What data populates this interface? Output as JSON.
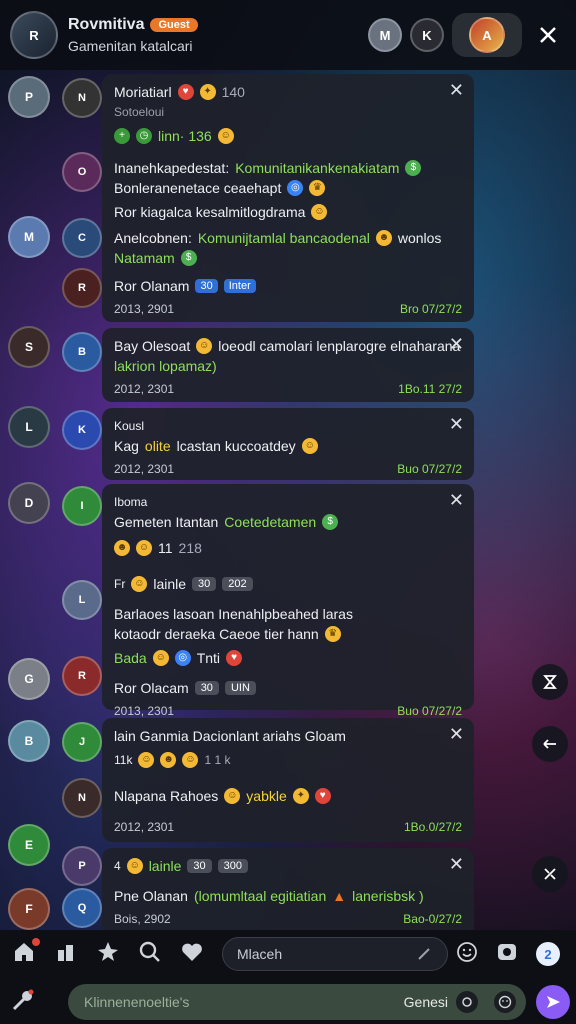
{
  "header": {
    "title": "Rovmitiva",
    "badge": "Guest",
    "subtitle": "Gamenitan katalcari"
  },
  "cards": [
    {
      "name": "Moriatiarl",
      "name_suffix": "140",
      "line2": "Sotoeloui",
      "line3": "linn· 136",
      "text1a": "Inanehkapedestat:",
      "text1b": "Komunitanikankenakiatam",
      "text2": "Bonleranenetace ceaehapt",
      "text3": "Ror kiagalca kesalmitlogdrama",
      "text4a": "Anelcobnen:",
      "text4b": "Komunijtamlal bancaodenal",
      "text4c": "wonlos",
      "text5": "Natamam",
      "name2": "Ror Olanam",
      "pill_a": "30",
      "pill_b": "Inter",
      "date": "2013, 2901",
      "time": "Bro 07/27/2"
    },
    {
      "line1": "Bay Olesoat",
      "line1b": "loeodl camolari lenplarogre elnaharana",
      "line2": "lakrion lopamaz)",
      "date": "2012, 2301",
      "time": "1Bo.11 27/2"
    },
    {
      "line1": "Kousl",
      "line2a": "Kag",
      "line2b": "olite",
      "line2c": "lcastan kuccoatdey",
      "date": "2012, 2301",
      "time": "Buo 07/27/2"
    },
    {
      "line1": "Iboma",
      "line2a": "Gemeten Itantan",
      "line2b": "Coetedetamen",
      "line3": "11",
      "line3b": "218",
      "line4": "lainle",
      "pill_a": "30",
      "pill_b": "202",
      "text1": "Barlaoes lasoan Inenahlpbeahed laras",
      "text2": "kotaodr deraeka Caeoe tier hann",
      "text3": "Bada",
      "text3b": "Tnti",
      "name2": "Ror Olacam",
      "pill_c": "30",
      "pill_d": "UIN",
      "date": "2013, 2301",
      "time": "Buo 07/27/2"
    },
    {
      "line1": "lain Ganmia Dacionlant ariahs Gloam",
      "line2": "11k",
      "line2b": "1 1 k",
      "line3a": "Nlapana Rahoes",
      "line3b": "yabkle",
      "date": "2012, 2301",
      "time": "1Bo.0/27/2"
    },
    {
      "line1a": "lainle",
      "pill_a": "30",
      "pill_b": "300",
      "line2a": "Pne Olanan",
      "line2b": "(lomumltaal egitiatian",
      "line2c": "lanerisbsk )",
      "date": "Bois, 2902",
      "time": "Bao-0/27/2"
    }
  ],
  "bottom": {
    "search_placeholder": "Mlaceh",
    "notif_count": "2",
    "compose_placeholder": "Klinnenenoeltie's",
    "compose_label": "Genesi"
  },
  "colors": {
    "accent_green": "#8ee05a",
    "send": "#8a5cf5",
    "badge_orange": "#e8772a"
  }
}
